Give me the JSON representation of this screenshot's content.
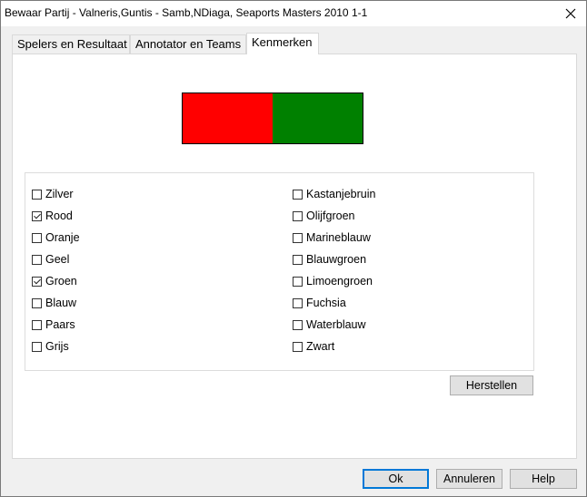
{
  "window": {
    "title": "Bewaar Partij - Valneris,Guntis - Samb,NDiaga, Seaports Masters 2010 1-1"
  },
  "tabs": [
    {
      "label": "Spelers en Resultaat"
    },
    {
      "label": "Annotator en Teams"
    },
    {
      "label": "Kenmerken",
      "active": true
    }
  ],
  "swatch": {
    "colors": [
      "#ff0000",
      "#008000"
    ]
  },
  "colors_left": [
    {
      "label": "Zilver",
      "checked": false
    },
    {
      "label": "Rood",
      "checked": true
    },
    {
      "label": "Oranje",
      "checked": false
    },
    {
      "label": "Geel",
      "checked": false
    },
    {
      "label": "Groen",
      "checked": true
    },
    {
      "label": "Blauw",
      "checked": false
    },
    {
      "label": "Paars",
      "checked": false
    },
    {
      "label": "Grijs",
      "checked": false
    }
  ],
  "colors_right": [
    {
      "label": "Kastanjebruin",
      "checked": false
    },
    {
      "label": "Olijfgroen",
      "checked": false
    },
    {
      "label": "Marineblauw",
      "checked": false
    },
    {
      "label": "Blauwgroen",
      "checked": false
    },
    {
      "label": "Limoengroen",
      "checked": false
    },
    {
      "label": "Fuchsia",
      "checked": false
    },
    {
      "label": "Waterblauw",
      "checked": false
    },
    {
      "label": "Zwart",
      "checked": false
    }
  ],
  "buttons": {
    "reset": "Herstellen",
    "ok": "Ok",
    "cancel": "Annuleren",
    "help": "Help"
  }
}
